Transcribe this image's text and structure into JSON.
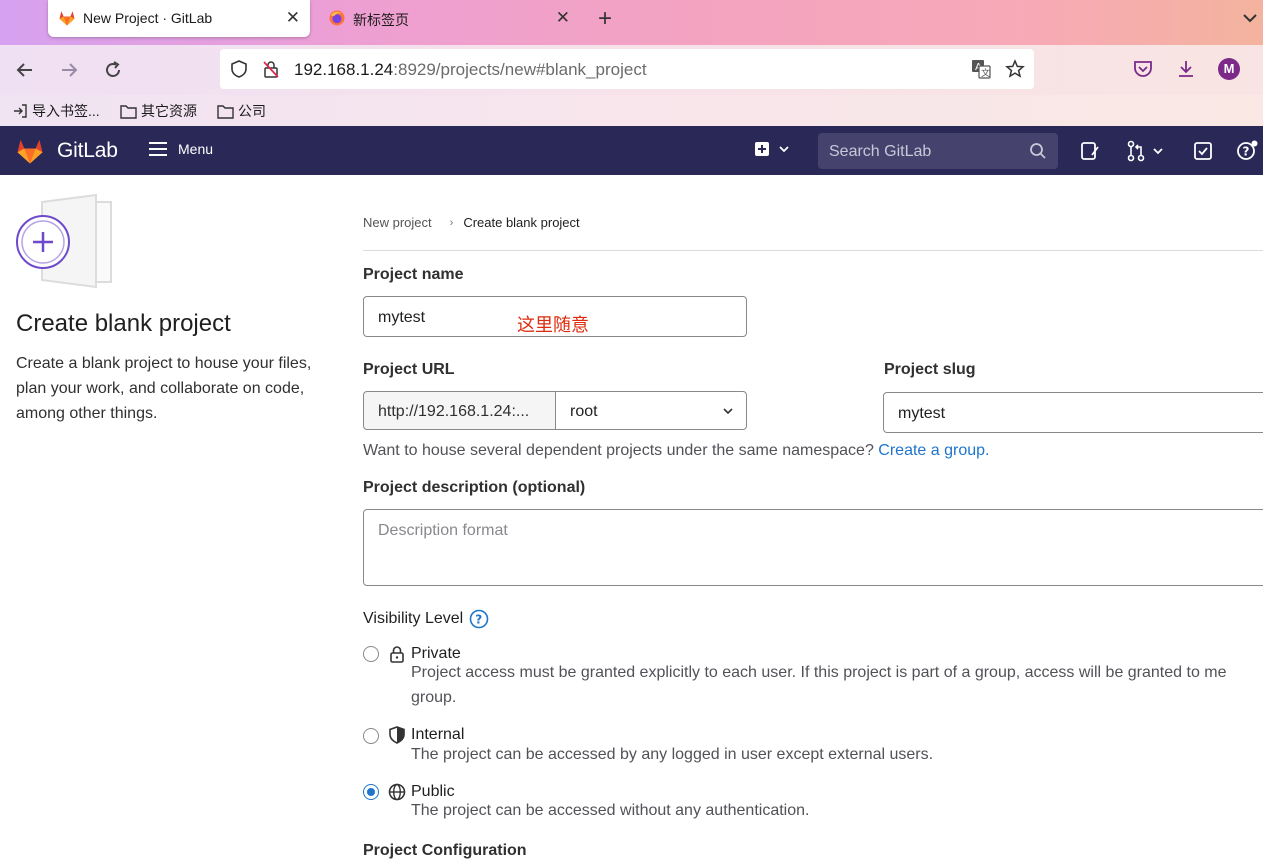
{
  "browser": {
    "tabs": [
      {
        "title": "New Project · GitLab",
        "close": "✕"
      },
      {
        "title": "新标签页",
        "close": "✕"
      }
    ],
    "new_tab": "+",
    "url_host": "192.168.1.24",
    "url_rest": ":8929/projects/new#blank_project",
    "bookmarks": [
      "导入书签...",
      "其它资源",
      "公司"
    ],
    "avatar_letter": "M"
  },
  "gitlab": {
    "brand": "GitLab",
    "menu_label": "Menu",
    "search_placeholder": "Search GitLab"
  },
  "left": {
    "title": "Create blank project",
    "description": "Create a blank project to house your files, plan your work, and collaborate on code, among other things."
  },
  "breadcrumb": {
    "parent": "New project",
    "current": "Create blank project"
  },
  "form": {
    "project_name_label": "Project name",
    "project_name_value": "mytest",
    "annotation": "这里随意",
    "project_url_label": "Project URL",
    "url_prefix": "http://192.168.1.24:...",
    "namespace_value": "root",
    "project_slug_label": "Project slug",
    "project_slug_value": "mytest",
    "group_help_text": "Want to house several dependent projects under the same namespace? ",
    "group_help_link": "Create a group.",
    "description_label": "Project description (optional)",
    "description_placeholder": "Description format",
    "visibility_label": "Visibility Level",
    "visibility_options": [
      {
        "label": "Private",
        "icon": "lock-icon",
        "checked": false,
        "desc1": "Project access must be granted explicitly to each user. If this project is part of a group, access will be granted to me",
        "desc2": "group."
      },
      {
        "label": "Internal",
        "icon": "shield-icon",
        "checked": false,
        "desc1": "The project can be accessed by any logged in user except external users."
      },
      {
        "label": "Public",
        "icon": "globe-icon",
        "checked": true,
        "desc1": "The project can be accessed without any authentication."
      }
    ],
    "next_section_partial": "Project Configuration"
  },
  "colors": {
    "header_bg": "#2a2856",
    "link": "#1f75cb",
    "annotation": "#dd2b0e"
  }
}
